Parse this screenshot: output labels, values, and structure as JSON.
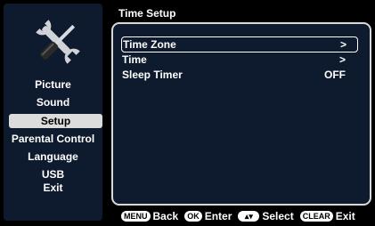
{
  "sidebar": {
    "icon": "tools-icon",
    "items": [
      {
        "label": "Picture"
      },
      {
        "label": "Sound"
      },
      {
        "label": "Setup"
      },
      {
        "label": "Parental Control"
      },
      {
        "label": "Language"
      },
      {
        "label": "USB"
      },
      {
        "label": "Exit"
      }
    ],
    "selected_index": 2
  },
  "main": {
    "title": "Time Setup",
    "rows": [
      {
        "label": "Time Zone",
        "value": ">"
      },
      {
        "label": "Time",
        "value": ">"
      },
      {
        "label": "Sleep Timer",
        "value": "OFF"
      }
    ],
    "selected_index": 0
  },
  "footer": {
    "items": [
      {
        "key": "MENU",
        "label": "Back"
      },
      {
        "key": "OK",
        "label": "Enter"
      },
      {
        "key": "▴▾",
        "label": "Select"
      },
      {
        "key": "CLEAR",
        "label": "Exit"
      }
    ]
  },
  "colors": {
    "panel_bg": "#0e1a2d",
    "selected_bg": "#dcdcdc",
    "text": "#ffffff"
  }
}
